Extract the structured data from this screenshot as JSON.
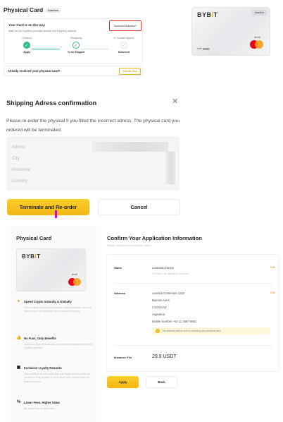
{
  "panel1": {
    "title": "Physical Card",
    "tag": "Inactive",
    "status_title": "Your Card is on the way",
    "status_subtitle": "Wait for our logistics provider accept the shipping request.",
    "incorrect_button": "Incorrect Address?",
    "steps": [
      {
        "top": "Ordered",
        "bottom": "Apply",
        "done": true
      },
      {
        "top": "Receiving",
        "bottom": "To be Shipped",
        "done": true
      },
      {
        "top": "In Transit/Shipped",
        "bottom": "Delivered",
        "done": false
      }
    ],
    "resolved_text": "Already received your physical card?",
    "activate_button": "Activate Now",
    "card": {
      "brand": "BYBIT",
      "badge": "Inactive",
      "type": "debit",
      "number": "**** 0000"
    }
  },
  "panel2": {
    "title": "Shipping Adress confirmation",
    "description": "Please re-order the physical if you filled the incorrect adress. The physical card you ordered will be terminated.",
    "fields": [
      "Adress",
      "City",
      "Postcode",
      "Country"
    ],
    "primary_button": "Terminate and Re-order",
    "secondary_button": "Cancel"
  },
  "panel3": {
    "left_title": "Physical Card",
    "card": {
      "brand": "BYBIT",
      "type": "debit"
    },
    "benefits": [
      {
        "title": "Spend Crypto Instantly & Globally",
        "body": "Pay at millions of locations worldwide using Mastercard. Use your Bybit account. No additional fees or accounts required.",
        "icon": "coin-icon"
      },
      {
        "title": "No Fuss, Only Benefits",
        "body": "Obtain the Bybit physical debit card with zero shipping fees and no monthly card fees.",
        "icon": "thumbs-up-icon"
      },
      {
        "title": "Exclusive Loyalty Rewards",
        "body": "Earn cashback on every purchase and loyalty rewards points on purchases. Plus, rewards in other offers, extra rewards from our partners & more.",
        "icon": "gift-icon"
      },
      {
        "title": "Lower Fees, Higher Value",
        "body": "No annual fees or hidden fees.",
        "icon": "percent-icon"
      }
    ],
    "right_title": "Confirm Your Application Information",
    "right_subtitle": "Please confirm the information stated.",
    "name_label": "Name",
    "name_value": "Leonardo Roque",
    "name_hint": "The name will display on your card.",
    "address_label": "Address",
    "address_lines": [
      "Avenida Corrientes 1234",
      "Buenos Aires",
      "C1043AAZ",
      "Argentina",
      "Mobile Number +54 11 4567-8901"
    ],
    "notice": "The address will be use for receiving your physical card.",
    "fee_label": "Issuance Fee",
    "fee_value": "29.9 USDT",
    "edit_label": "Edit",
    "apply_button": "Apply",
    "back_button": "Back"
  },
  "colors": {
    "accent": "#FCD535",
    "alert": "#E02B2B",
    "success": "#2EBD85",
    "cursor": "#D400D4"
  }
}
